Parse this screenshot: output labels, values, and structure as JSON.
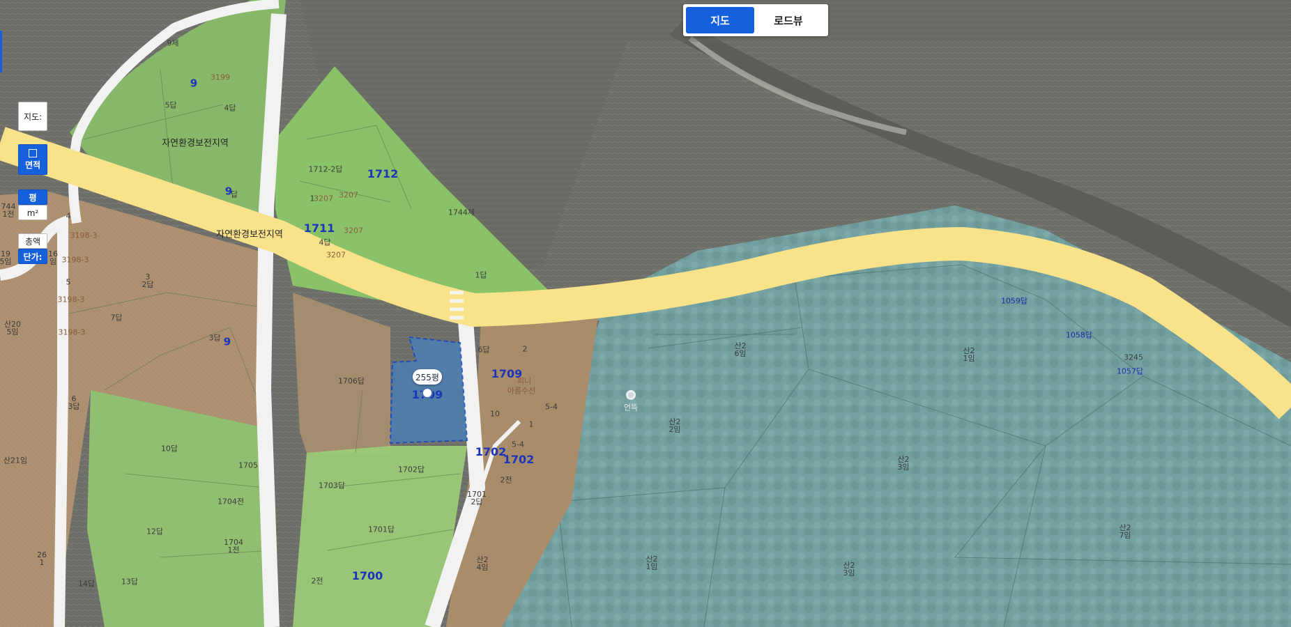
{
  "map_tabs": {
    "map": "지도",
    "roadview": "로드뷰"
  },
  "side_controls": {
    "map_type": "지도:",
    "area": "면적",
    "unit_pyeong": "평",
    "unit_m2": "m²",
    "total": "총액",
    "unit_price": "단가:"
  },
  "selected_parcel": {
    "area_badge": "255평",
    "number": "1709"
  },
  "zone_labels": [
    "자연환경보전지역",
    "자연환경보전지역"
  ],
  "poi": {
    "name": "언뜩",
    "shop": "아름수선",
    "shop_sub": "피니"
  },
  "parcels": {
    "p9a": "9",
    "p9b": "9",
    "p9c": "9",
    "p9d": "9",
    "p1712": "1712",
    "p1711": "1711",
    "p1709": "1709",
    "p1702a": "1702",
    "p1702b": "1702",
    "p1700": "1700",
    "s_9je": "9제",
    "s_3199": "3199",
    "s_5dap": "5답",
    "s_4dap": "4답",
    "s_9dap": "9답",
    "s_1712_2": "1712-2답",
    "s_3207a": "3207",
    "s_3207b": "3207",
    "s_3207c": "3207",
    "s_3207d": "3207",
    "s_4dap2": "4답",
    "s_1744": "1744제",
    "s_1dap": "1답",
    "s_4": "4",
    "s_3198_3": "3198-3",
    "s_3198_3b": "3198-3",
    "s_3198_3c": "3198-3",
    "s_3198_3d": "3198-3",
    "s_5": "5",
    "s_3_2dap": "3\n2답",
    "s_7dap": "7답",
    "s_3dap": "3답",
    "s_744": "744\n1전",
    "s_19": "19\n5임",
    "s_16": "16\n임",
    "s_san20": "산20\n5임",
    "s_6_3dap": "6\n3답",
    "s_1706": "1706답",
    "s_6dap": "6답",
    "s_2": "2",
    "s_10": "10",
    "s_1": "1",
    "s_5_4": "5-4",
    "s_5_4b": "5-4",
    "s_2jeon": "2전",
    "s_1701": "1701\n2답",
    "s_10dap": "10답",
    "s_1705": "1705",
    "s_1704": "1704전",
    "s_1703": "1703답",
    "s_1702dap": "1702답",
    "s_1701dap": "1701답",
    "s_12dap": "12답",
    "s_1704_1": "1704\n1전",
    "s_14dap": "14답",
    "s_13dap": "13답",
    "s_2jeon2": "2전",
    "s_san21": "산21임",
    "s_26_1": "26\n1",
    "s_san2_4": "산2\n4임",
    "s_1059": "1059답",
    "s_1058": "1058답",
    "s_1057": "1057답",
    "s_san_6": "산2\n6임",
    "s_san_1a": "산2\n1임",
    "s_san_2": "산2\n2임",
    "s_san_3": "산2\n3임",
    "s_san_1b": "산2\n1임",
    "s_san_3b": "산2\n3임",
    "s_san_7": "산2\n7임",
    "s_3245": "3245"
  }
}
